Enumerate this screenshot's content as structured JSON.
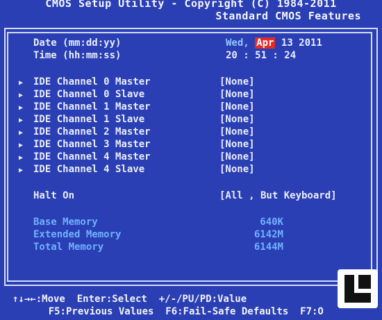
{
  "header": {
    "line1": "CMOS Setup Utility - Copyright (C) 1984-2011",
    "line2": "Standard CMOS Features"
  },
  "datetime": {
    "date_label": "Date (mm:dd:yy)",
    "time_label": "Time (hh:mm:ss)",
    "day": "Wed,",
    "month": "Apr",
    "date_rest": "13 2011",
    "time_value": "20 : 51 : 24"
  },
  "ide": [
    {
      "label": "IDE Channel 0 Master",
      "value": "[None]"
    },
    {
      "label": "IDE Channel 0 Slave",
      "value": "[None]"
    },
    {
      "label": "IDE Channel 1 Master",
      "value": "[None]"
    },
    {
      "label": "IDE Channel 1 Slave",
      "value": "[None]"
    },
    {
      "label": "IDE Channel 2 Master",
      "value": "[None]"
    },
    {
      "label": "IDE Channel 3 Master",
      "value": "[None]"
    },
    {
      "label": "IDE Channel 4 Master",
      "value": "[None]"
    },
    {
      "label": "IDE Channel 4 Slave",
      "value": "[None]"
    }
  ],
  "halt": {
    "label": "Halt On",
    "value": "[All , But Keyboard]"
  },
  "memory": [
    {
      "label": "Base Memory",
      "value": "640K"
    },
    {
      "label": "Extended Memory",
      "value": "6142M"
    },
    {
      "label": "Total Memory",
      "value": "6144M"
    }
  ],
  "footer": {
    "line1": "↑↓→←:Move  Enter:Select  +/-/PU/PD:Value",
    "line2": "    F5:Previous Values  F6:Fail-Safe Defaults  F7:O"
  },
  "colors": {
    "background": "#2b3fb4",
    "highlight": "#e22b2b",
    "memory_text": "#6fb1ff"
  },
  "icons": {
    "arrow": "triangle-right",
    "logo": "legit-reviews-logo"
  }
}
